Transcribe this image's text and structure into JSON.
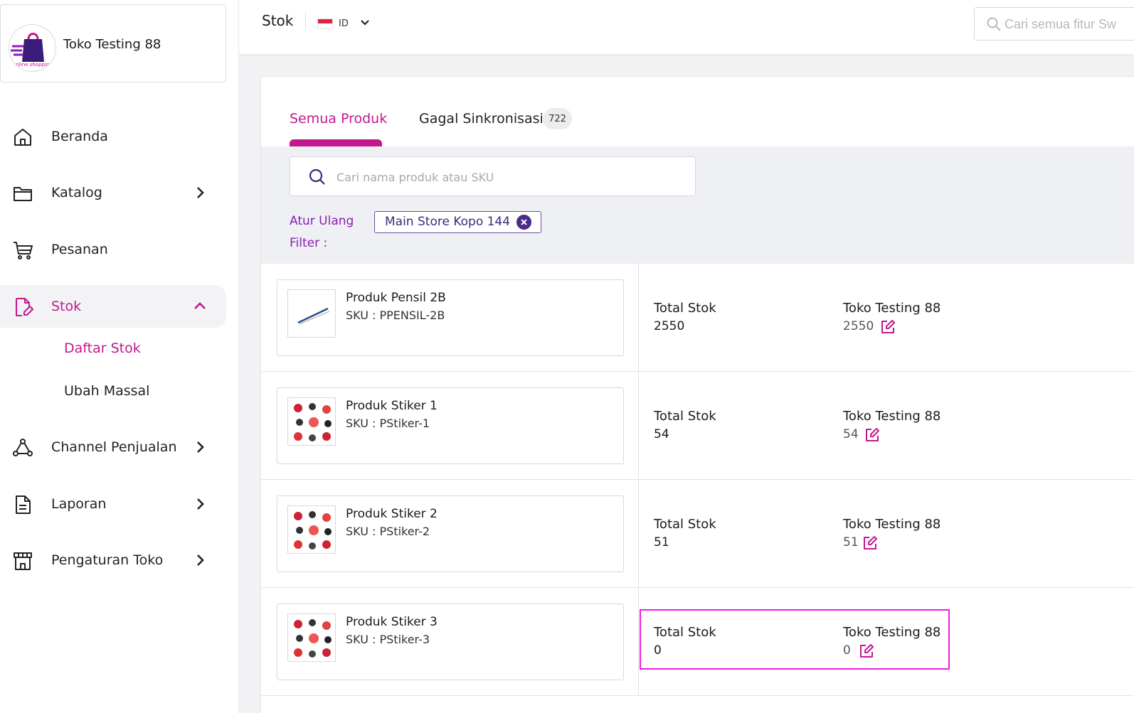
{
  "sidebar": {
    "store_name": "Toko Testing 88",
    "logo_text": "online shopping",
    "items": [
      {
        "label": "Beranda",
        "icon": "home-icon"
      },
      {
        "label": "Katalog",
        "icon": "folder-icon"
      },
      {
        "label": "Pesanan",
        "icon": "cart-icon"
      },
      {
        "label": "Stok",
        "icon": "stock-edit-icon"
      },
      {
        "label": "Channel Penjualan",
        "icon": "channel-icon"
      },
      {
        "label": "Laporan",
        "icon": "report-icon"
      },
      {
        "label": "Pengaturan Toko",
        "icon": "store-settings-icon"
      }
    ],
    "sub_items": [
      {
        "label": "Daftar Stok"
      },
      {
        "label": "Ubah Massal"
      }
    ]
  },
  "topbar": {
    "title": "Stok",
    "language_code": "ID",
    "search_placeholder": "Cari semua fitur Sw"
  },
  "tabs": [
    {
      "label": "Semua Produk",
      "active": true
    },
    {
      "label": "Gagal Sinkronisasi",
      "badge": "722"
    }
  ],
  "filters": {
    "search_placeholder": "Cari nama produk atau SKU",
    "reset_label": "Atur Ulang",
    "filter_label": "Filter :",
    "chip_label": "Main Store Kopo 144"
  },
  "products": [
    {
      "name": "Produk Pensil 2B",
      "sku": "SKU : PPENSIL-2B",
      "total_label": "Total Stok",
      "total": "2550",
      "store": "Toko Testing 88",
      "store_stock": "2550"
    },
    {
      "name": "Produk Stiker 1",
      "sku": "SKU : PStiker-1",
      "total_label": "Total Stok",
      "total": "54",
      "store": "Toko Testing 88",
      "store_stock": "54"
    },
    {
      "name": "Produk Stiker 2",
      "sku": "SKU : PStiker-2",
      "total_label": "Total Stok",
      "total": "51",
      "store": "Toko Testing 88",
      "store_stock": "51"
    },
    {
      "name": "Produk Stiker 3",
      "sku": "SKU : PStiker-3",
      "total_label": "Total Stok",
      "total": "0",
      "store": "Toko Testing 88",
      "store_stock": "0"
    }
  ],
  "colors": {
    "accent": "#c2188e",
    "secondary": "#8a1db5",
    "highlight": "#ee1ce0"
  }
}
